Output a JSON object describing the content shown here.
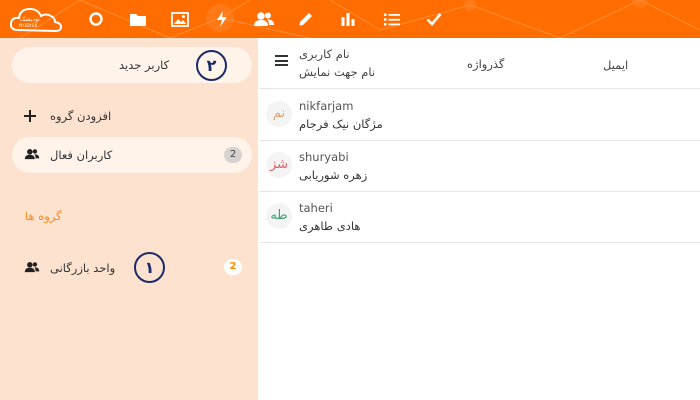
{
  "colors": {
    "brand": "#ff6d00",
    "sidebar_bg": "#fde2cf",
    "accent_text": "#ff8a1a",
    "callout": "#1a2b6b"
  },
  "logo": {
    "name": "nodish-logo",
    "text": "نودیشک",
    "subtext": "NODISK"
  },
  "nav": [
    "circle-icon",
    "folder-icon",
    "image-icon",
    "bolt-icon",
    "users-icon",
    "pencil-icon",
    "bar-chart-icon",
    "list-icon",
    "check-icon"
  ],
  "sidebar": {
    "new_user_button": "کاربر جدید",
    "new_user_callout": "۲",
    "add_group": "افزودن گروه",
    "active_users": "کاربران فعال",
    "active_users_count": "2",
    "groups_heading": "گروه ها",
    "groups": [
      {
        "label": "واحد بازرگانی",
        "count": "2",
        "callout": "١"
      }
    ]
  },
  "table": {
    "headers": {
      "email": "ایمیل",
      "password": "گذرواژه",
      "username": "نام کاربری",
      "display_name": "نام جهت نمایش"
    },
    "rows": [
      {
        "initials": "نم",
        "username": "nikfarjam",
        "name": "مژگان نیک فرجام",
        "avatar_color": "#e0a070"
      },
      {
        "initials": "شز",
        "username": "shuryabi",
        "name": "زهره شوریابی",
        "avatar_color": "#e06060"
      },
      {
        "initials": "طه",
        "username": "taheri",
        "name": "هادی طاهری",
        "avatar_color": "#3a9e6e"
      }
    ]
  }
}
